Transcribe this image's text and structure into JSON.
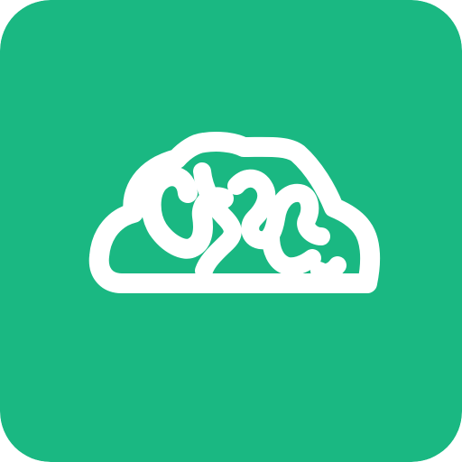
{
  "icon": {
    "name": "brain-cloud-icon",
    "colors": {
      "background": "#1AB882",
      "foreground": "#FFFFFF"
    }
  }
}
